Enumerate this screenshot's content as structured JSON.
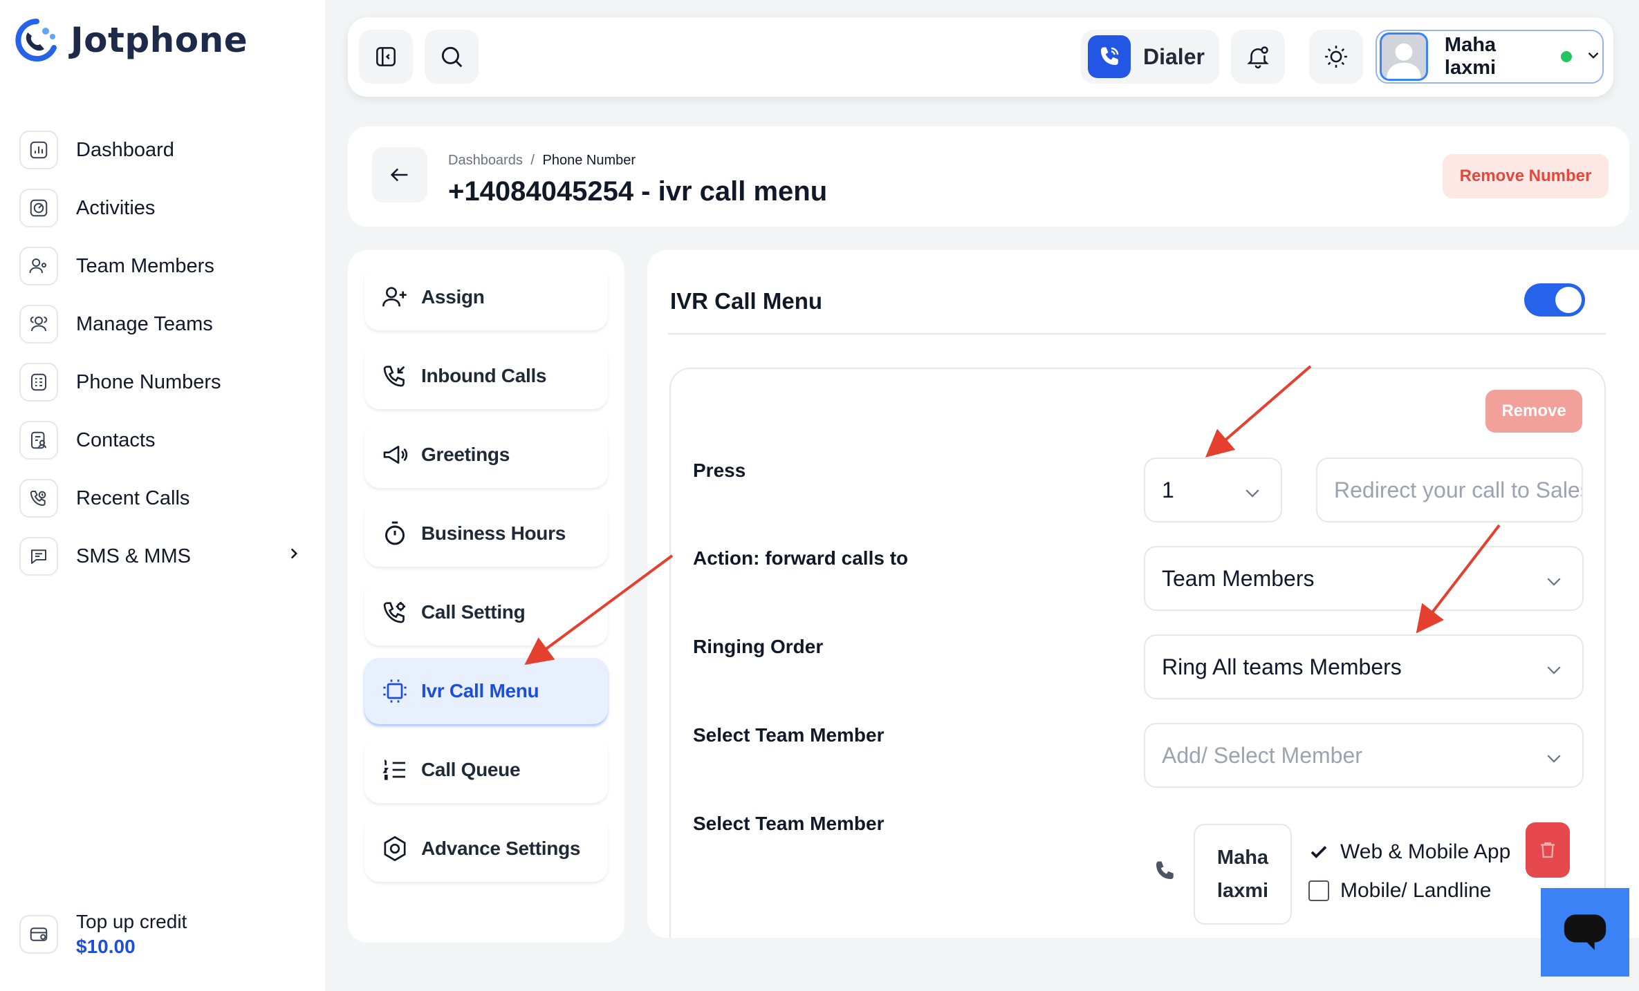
{
  "app": {
    "name": "Jotphone"
  },
  "sidebar": {
    "items": [
      {
        "label": "Dashboard",
        "icon": "dashboard-icon"
      },
      {
        "label": "Activities",
        "icon": "activities-icon"
      },
      {
        "label": "Team Members",
        "icon": "team-members-icon"
      },
      {
        "label": "Manage Teams",
        "icon": "manage-teams-icon"
      },
      {
        "label": "Phone Numbers",
        "icon": "phone-numbers-icon"
      },
      {
        "label": "Contacts",
        "icon": "contacts-icon"
      },
      {
        "label": "Recent Calls",
        "icon": "recent-calls-icon"
      },
      {
        "label": "SMS & MMS",
        "icon": "sms-icon"
      }
    ],
    "credit": {
      "label": "Top up credit",
      "value": "$10.00"
    }
  },
  "header": {
    "dialer_label": "Dialer",
    "user": {
      "name": "Maha laxmi",
      "status_color": "#22c55e"
    }
  },
  "page": {
    "breadcrumb": {
      "parent": "Dashboards",
      "separator": "/",
      "current": "Phone Number"
    },
    "title": "+14084045254 - ivr call menu",
    "remove_number_label": "Remove Number"
  },
  "settings_menu": {
    "items": [
      {
        "label": "Assign",
        "icon": "user-plus-icon"
      },
      {
        "label": "Inbound Calls",
        "icon": "inbound-call-icon"
      },
      {
        "label": "Greetings",
        "icon": "megaphone-icon"
      },
      {
        "label": "Business Hours",
        "icon": "stopwatch-icon"
      },
      {
        "label": "Call Setting",
        "icon": "call-settings-icon"
      },
      {
        "label": "Ivr Call Menu",
        "icon": "ivr-menu-icon",
        "active": true
      },
      {
        "label": "Call Queue",
        "icon": "ordered-list-icon"
      },
      {
        "label": "Advance Settings",
        "icon": "hexagon-settings-icon"
      }
    ]
  },
  "ivr": {
    "heading": "IVR Call Menu",
    "enabled": true,
    "remove_label": "Remove",
    "press_label": "Press",
    "press_value": "1",
    "redirect_placeholder": "Redirect your call to Sales",
    "action_label": "Action: forward calls to",
    "action_value": "Team Members",
    "ringing_label": "Ringing Order",
    "ringing_value": "Ring All teams Members",
    "select_member_label": "Select Team Member",
    "select_member_placeholder": "Add/ Select Member",
    "selected_member_label": "Select Team Member",
    "member": {
      "first_name": "Maha",
      "last_name": "laxmi",
      "web_app_label": "Web & Mobile App",
      "web_app_checked": true,
      "landline_label": "Mobile/ Landline",
      "landline_checked": false
    }
  },
  "colors": {
    "accent": "#2563eb",
    "danger": "#e5483b",
    "annotation_arrow": "#e5402f"
  }
}
